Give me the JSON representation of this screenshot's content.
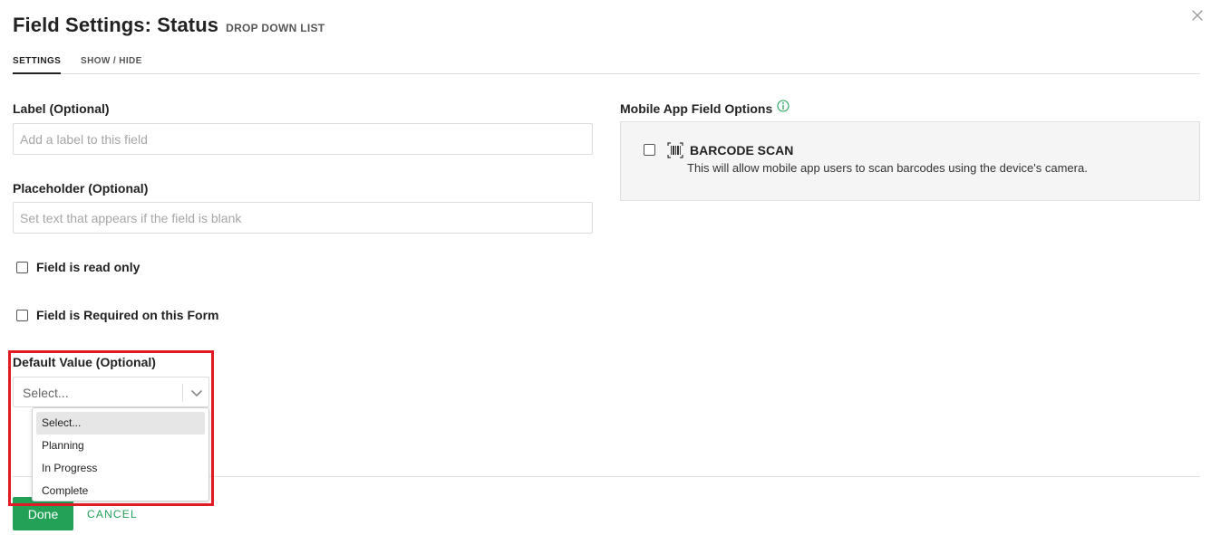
{
  "header": {
    "title": "Field Settings: Status",
    "subtitle": "DROP DOWN LIST"
  },
  "tabs": [
    {
      "label": "SETTINGS",
      "active": true
    },
    {
      "label": "SHOW / HIDE",
      "active": false
    }
  ],
  "form": {
    "label_field": {
      "label": "Label (Optional)",
      "value": "",
      "placeholder": "Add a label to this field"
    },
    "placeholder_field": {
      "label": "Placeholder (Optional)",
      "value": "",
      "placeholder": "Set text that appears if the field is blank"
    },
    "read_only": {
      "label": "Field is read only",
      "checked": false
    },
    "required": {
      "label": "Field is Required on this Form",
      "checked": false
    },
    "default_value": {
      "label": "Default Value (Optional)",
      "selected": "Select...",
      "options": [
        "Select...",
        "Planning",
        "In Progress",
        "Complete"
      ]
    }
  },
  "mobile": {
    "title": "Mobile App Field Options",
    "info_icon": "info-circle-icon",
    "barcode": {
      "label": "BARCODE SCAN",
      "description": "This will allow mobile app users to scan barcodes using the device's camera.",
      "checked": false,
      "icon": "barcode-icon"
    }
  },
  "footer": {
    "done_label": "Done",
    "cancel_label": "CANCEL"
  },
  "colors": {
    "accent_green": "#22a157",
    "highlight_red": "#e01b24"
  }
}
